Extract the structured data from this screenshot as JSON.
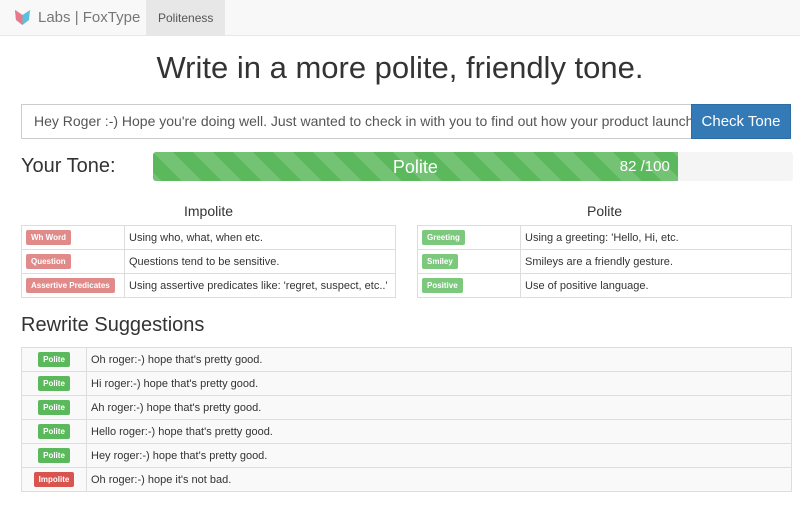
{
  "nav": {
    "brand": "Labs | FoxType",
    "item": "Politeness"
  },
  "title": "Write in a more polite, friendly tone.",
  "input": {
    "value": "Hey Roger :-) Hope you're doing well. Just wanted to check in with you to find out how your product launch went"
  },
  "check_button": "Check Tone",
  "tone": {
    "label": "Your Tone:",
    "result": "Polite",
    "score_text": "82 /100",
    "score": 82,
    "max": 100,
    "color": "#5cb85c"
  },
  "impolite": {
    "title": "Impolite",
    "rows": [
      {
        "tag": "Wh Word",
        "desc": "Using who, what, when etc."
      },
      {
        "tag": "Question",
        "desc": "Questions tend to be sensitive."
      },
      {
        "tag": "Assertive Predicates",
        "desc": "Using assertive predicates like: 'regret, suspect, etc..'"
      }
    ]
  },
  "polite": {
    "title": "Polite",
    "rows": [
      {
        "tag": "Greeting",
        "desc": "Using a greeting: 'Hello, Hi, etc."
      },
      {
        "tag": "Smiley",
        "desc": "Smileys are a friendly gesture."
      },
      {
        "tag": "Positive",
        "desc": "Use of positive language."
      }
    ]
  },
  "suggestions": {
    "title": "Rewrite Suggestions",
    "rows": [
      {
        "tag": "Polite",
        "text": "Oh roger:-) hope that's pretty good."
      },
      {
        "tag": "Polite",
        "text": "Hi roger:-) hope that's pretty good."
      },
      {
        "tag": "Polite",
        "text": "Ah roger:-) hope that's pretty good."
      },
      {
        "tag": "Polite",
        "text": "Hello roger:-) hope that's pretty good."
      },
      {
        "tag": "Polite",
        "text": "Hey roger:-) hope that's pretty good."
      },
      {
        "tag": "Impolite",
        "text": "Oh roger:-) hope it's not bad."
      }
    ]
  }
}
